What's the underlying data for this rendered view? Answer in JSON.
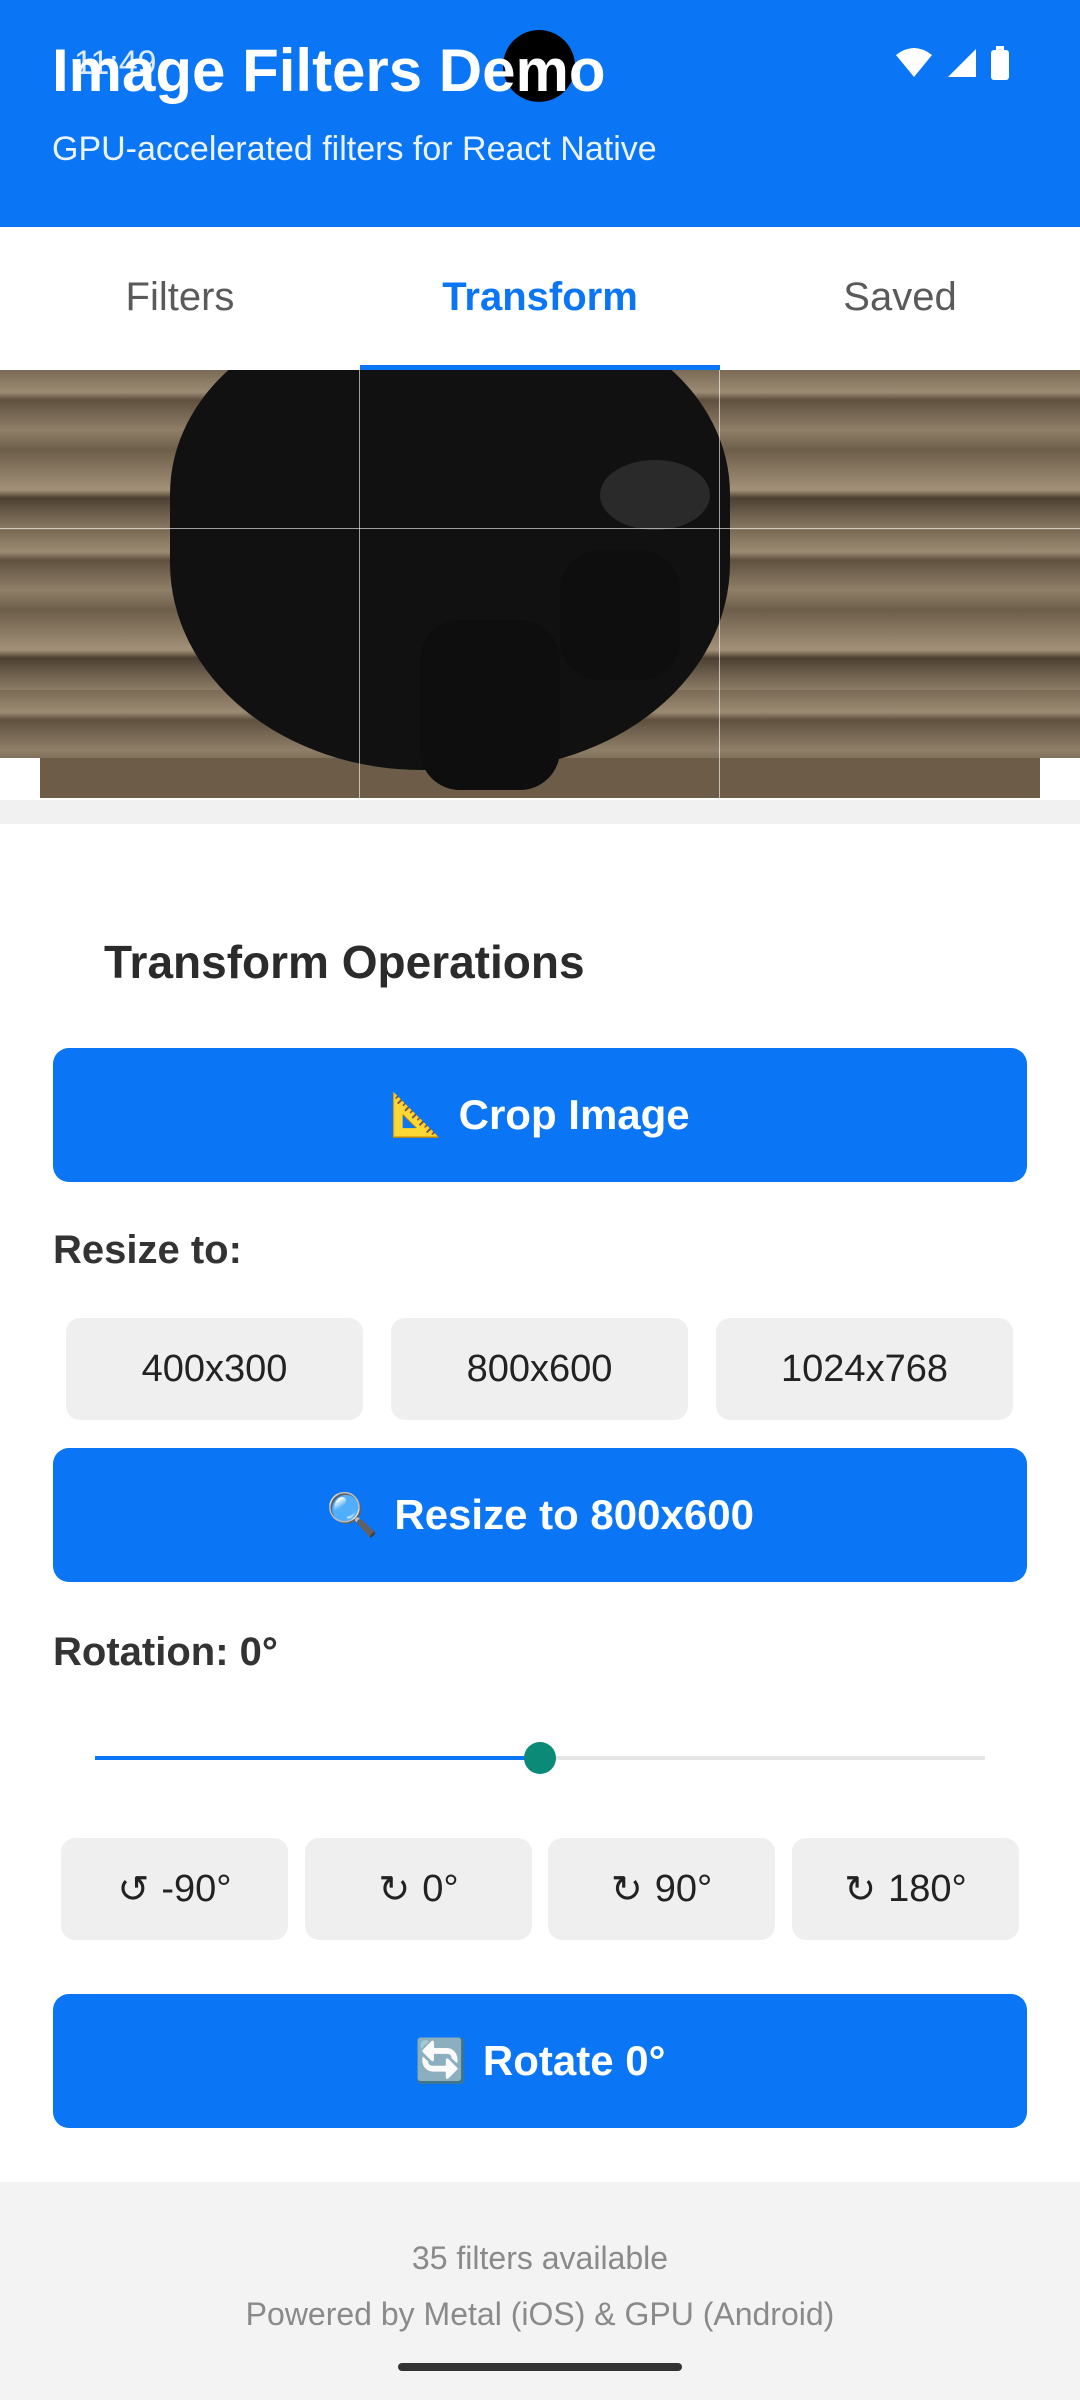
{
  "status_bar": {
    "time": "11:49"
  },
  "header": {
    "title": "Image Filters Demo",
    "subtitle": "GPU-accelerated filters for React Native",
    "accent": "#0a76f6"
  },
  "tabs": [
    {
      "label": "Filters",
      "active": false
    },
    {
      "label": "Transform",
      "active": true
    },
    {
      "label": "Saved",
      "active": false
    }
  ],
  "transform": {
    "section_title": "Transform Operations",
    "crop_button": {
      "icon": "📐",
      "label": "Crop Image"
    },
    "resize": {
      "label": "Resize to:",
      "options": [
        "400x300",
        "800x600",
        "1024x768"
      ],
      "selected": "800x600",
      "button": {
        "icon": "🔍",
        "label": "Resize to 800x600"
      }
    },
    "rotation": {
      "label": "Rotation: 0°",
      "slider_fraction": 0.5,
      "presets": [
        {
          "icon": "↺",
          "label": "-90°"
        },
        {
          "icon": "↻",
          "label": "0°"
        },
        {
          "icon": "↻",
          "label": "90°"
        },
        {
          "icon": "↻",
          "label": "180°"
        }
      ],
      "button": {
        "icon": "🔄",
        "label": "Rotate 0°"
      }
    }
  },
  "footer": {
    "line1": "35 filters available",
    "line2": "Powered by Metal (iOS) & GPU (Android)"
  }
}
